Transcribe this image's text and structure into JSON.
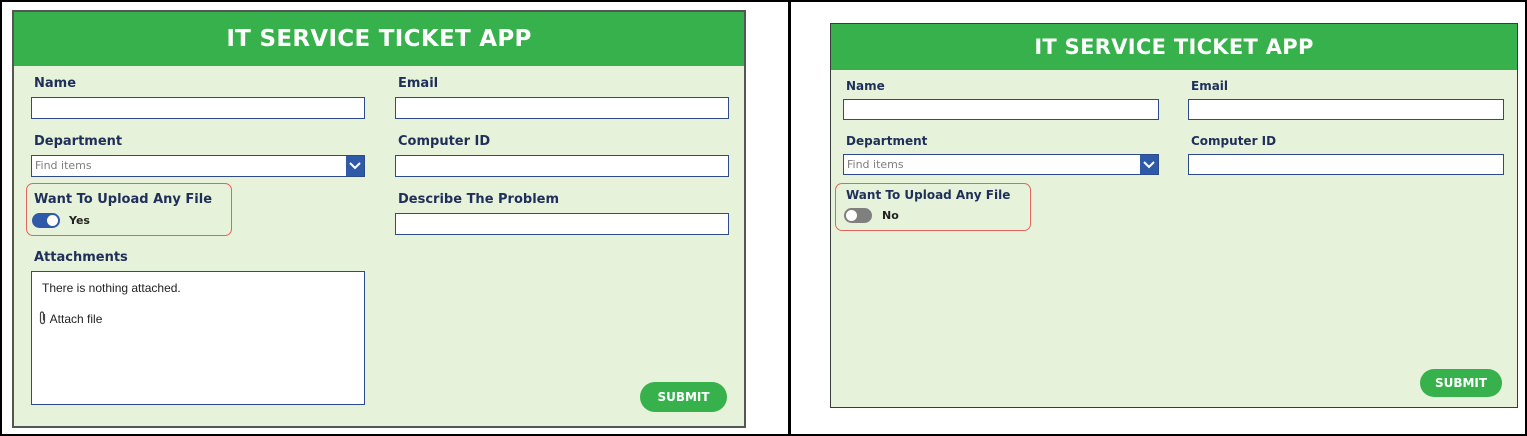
{
  "colors": {
    "header_green": "#37b14b",
    "form_bg": "#e6f2da",
    "field_border": "#2d4a8a",
    "toggle_on": "#2f5aa8",
    "toggle_off": "#7f7f7f",
    "highlight": "#e0675a"
  },
  "left": {
    "title": "IT SERVICE TICKET APP",
    "name_label": "Name",
    "email_label": "Email",
    "department_label": "Department",
    "department_placeholder": "Find items",
    "computer_id_label": "Computer ID",
    "upload_label": "Want To Upload Any File",
    "upload_state": "Yes",
    "upload_on": true,
    "problem_label": "Describe The Problem",
    "attachments_label": "Attachments",
    "attachments_empty": "There is nothing attached.",
    "attach_file": "Attach file",
    "submit": "SUBMIT"
  },
  "right": {
    "title": "IT SERVICE TICKET APP",
    "name_label": "Name",
    "email_label": "Email",
    "department_label": "Department",
    "department_placeholder": "Find items",
    "computer_id_label": "Computer ID",
    "upload_label": "Want To Upload Any File",
    "upload_state": "No",
    "upload_on": false,
    "submit": "SUBMIT"
  }
}
